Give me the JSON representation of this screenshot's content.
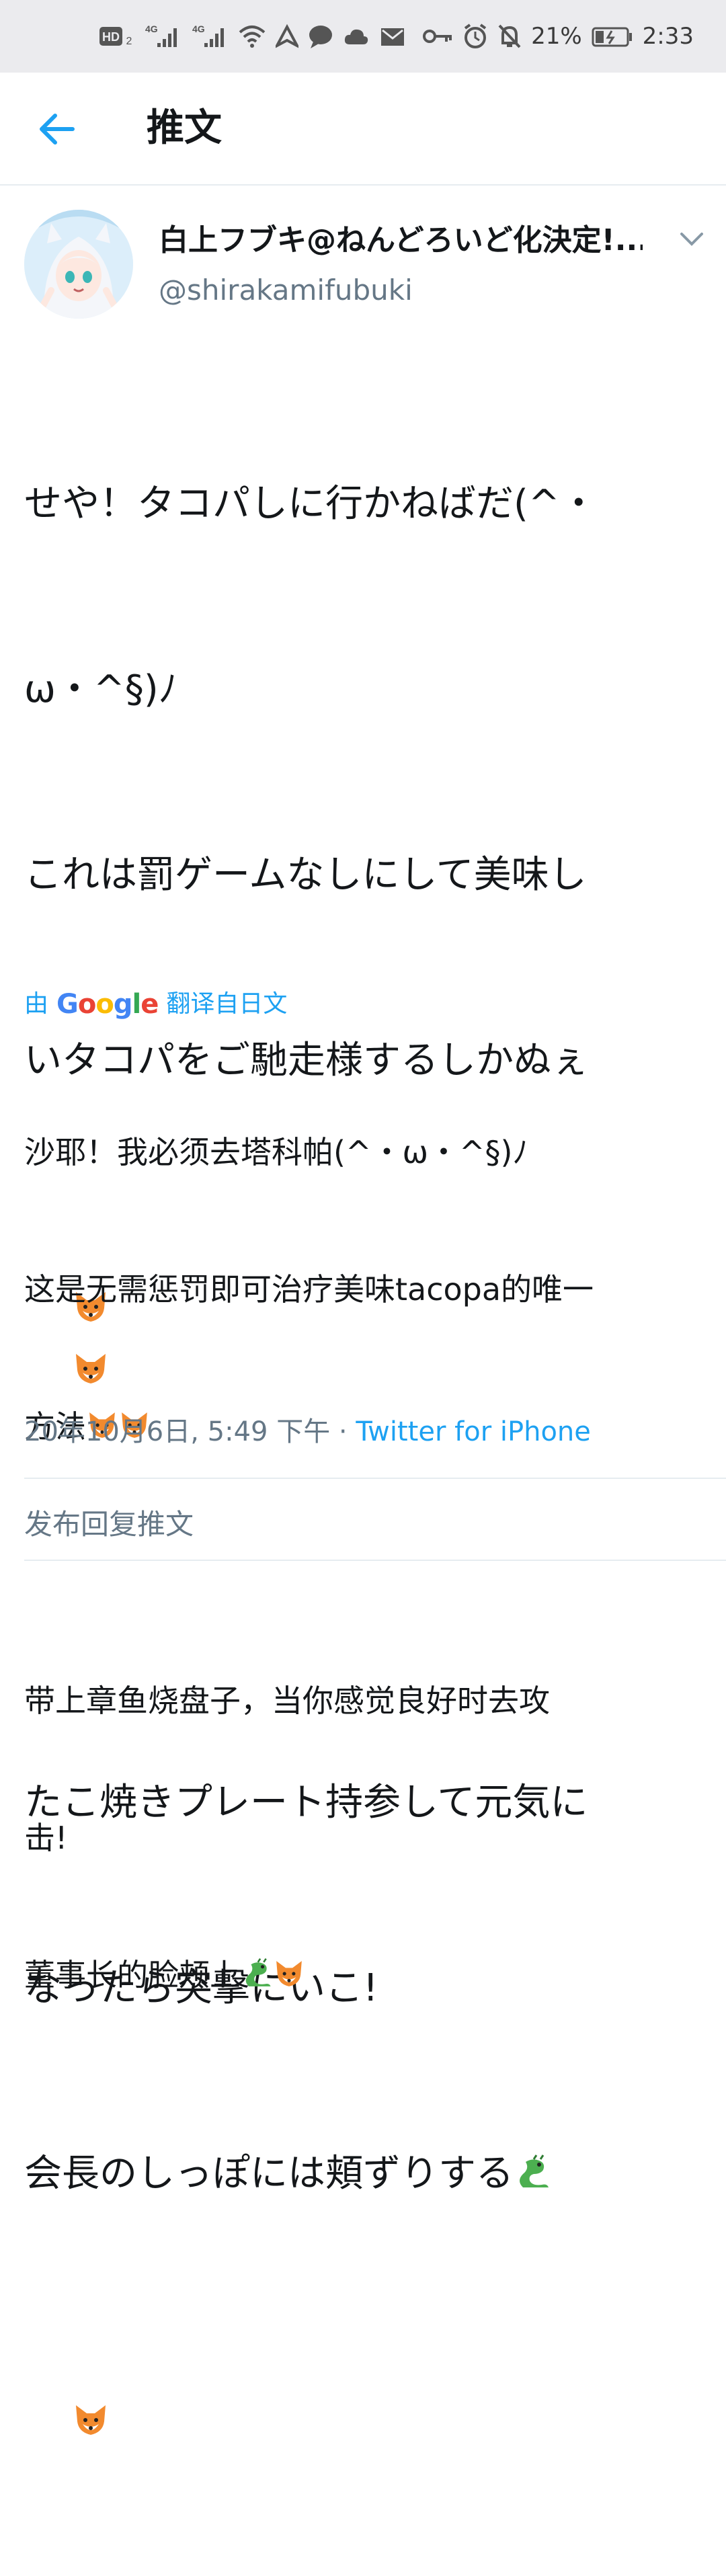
{
  "status_bar": {
    "left_icons": [
      "hd-icon",
      "signal-4g-icon",
      "signal-4g-icon",
      "wifi-icon",
      "navigation-icon",
      "message-icon",
      "cloud-icon",
      "mail-icon"
    ],
    "battery_percent": "21%",
    "time": "2:33"
  },
  "header": {
    "title": "推文"
  },
  "tweet": {
    "display_name": "白上フブキ@ねんどろいど化決定!...",
    "handle": "@shirakamifubuki",
    "text_lines": [
      "せや！タコパしに行かねばだ(^・",
      "ω・^§)ﾉ",
      "これは罰ゲームなしにして美味し",
      "いタコパをご馳走様するしかぬぇ",
      "",
      "",
      "たこ焼きプレート持参して元気に",
      "なったら突撃にいこ!",
      "会長のしっぽには頬ずりする",
      ""
    ],
    "translate_prefix": "由",
    "translate_brand": "Google",
    "translate_suffix": "翻译自日文",
    "translated_lines": [
      "沙耶！我必须去塔科帕(^・ω・^§)ﾉ",
      "这是无需惩罚即可治疗美味tacopa的唯一",
      "方法",
      "",
      "带上章鱼烧盘子，当你感觉良好时去攻",
      "击!",
      "董事长的脸颊上"
    ],
    "timestamp": "20年10月6日, 5:49 下午 · ",
    "source": "Twitter for iPhone"
  },
  "reply": {
    "placeholder": "发布回复推文"
  },
  "colors": {
    "accent": "#1da1f2",
    "secondary_text": "#657786",
    "divider": "#e6ecf0"
  }
}
